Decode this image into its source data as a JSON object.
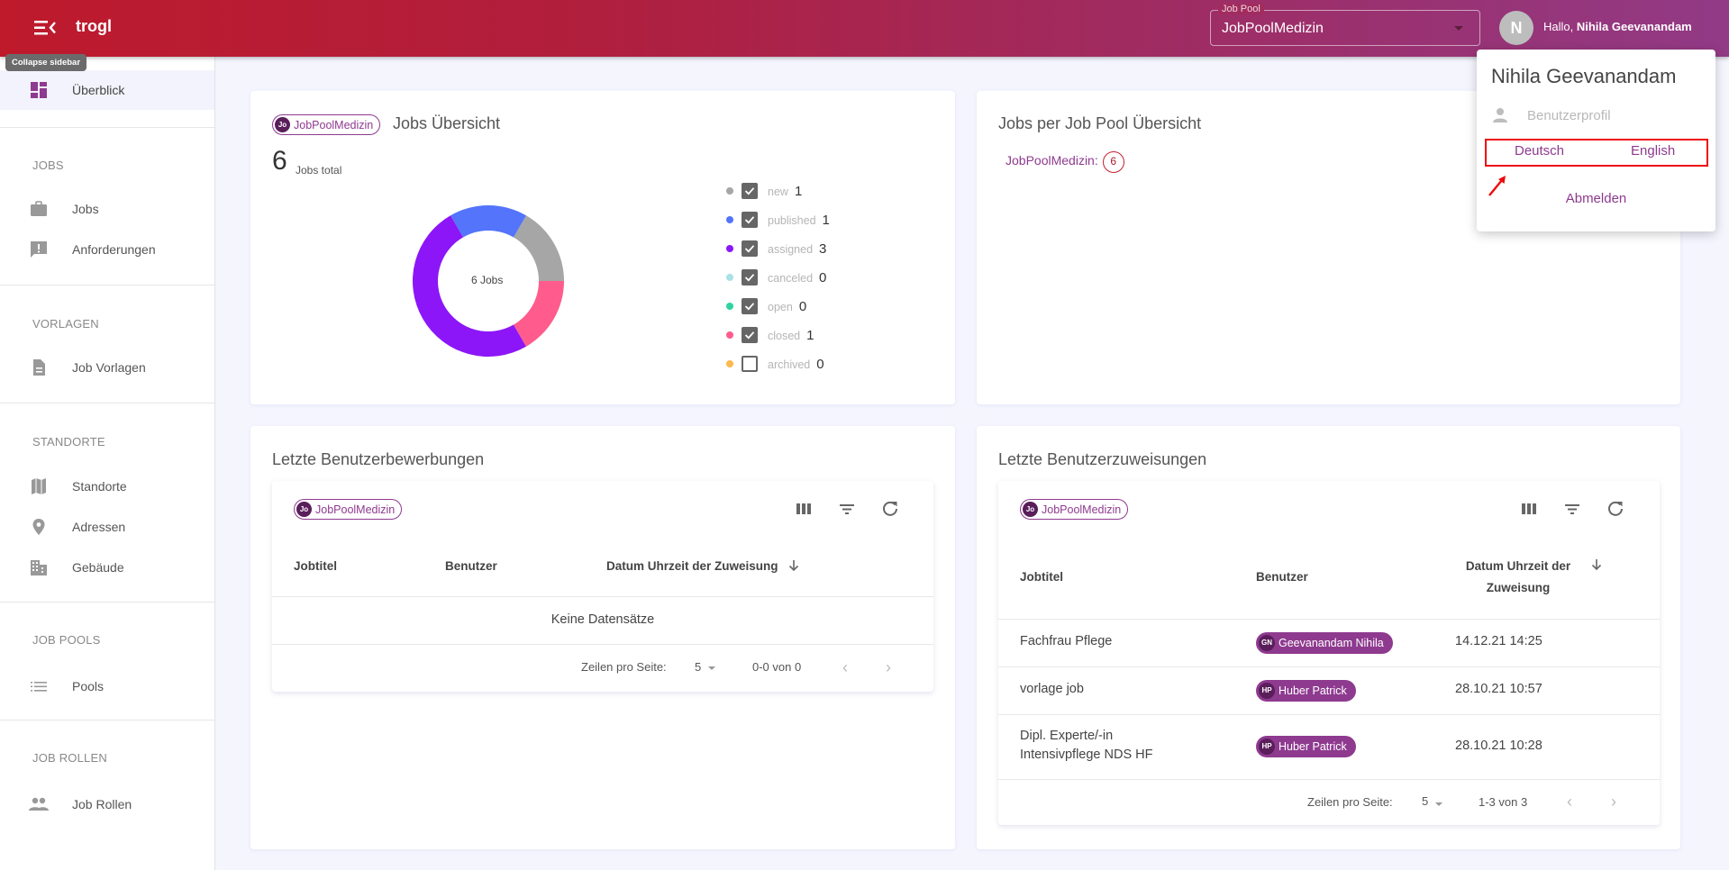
{
  "app": {
    "brand": "trogl",
    "collapse_tooltip": "Collapse sidebar"
  },
  "header": {
    "jobpool_label": "Job Pool",
    "jobpool_value": "JobPoolMedizin",
    "avatar_initial": "N",
    "greeting_prefix": "Hallo, ",
    "greeting_name": "Nihila Geevanandam"
  },
  "user_menu": {
    "name": "Nihila Geevanandam",
    "profile_label": "Benutzerprofil",
    "languages": [
      "Deutsch",
      "English"
    ],
    "logout_label": "Abmelden",
    "highlight_color": "#ee0a0a"
  },
  "sidebar": {
    "overview": "Überblick",
    "sections": [
      {
        "title": "JOBS",
        "items": [
          "Jobs",
          "Anforderungen"
        ]
      },
      {
        "title": "VORLAGEN",
        "items": [
          "Job Vorlagen"
        ]
      },
      {
        "title": "STANDORTE",
        "items": [
          "Standorte",
          "Adressen",
          "Gebäude"
        ]
      },
      {
        "title": "JOB POOLS",
        "items": [
          "Pools"
        ]
      },
      {
        "title": "JOB ROLLEN",
        "items": [
          "Job Rollen"
        ]
      }
    ]
  },
  "jobs_overview": {
    "chip_initials": "Jo",
    "chip_label": "JobPoolMedizin",
    "title": "Jobs Übersicht",
    "total": "6",
    "total_label": "Jobs total",
    "center_label": "6 Jobs"
  },
  "chart_data": {
    "type": "pie",
    "subtype": "doughnut",
    "title": "Jobs Übersicht",
    "center_label": "6 Jobs",
    "categories": [
      "new",
      "published",
      "assigned",
      "canceled",
      "open",
      "closed",
      "archived"
    ],
    "values": [
      1,
      1,
      3,
      0,
      0,
      1,
      0
    ],
    "colors": [
      "#a6a6a6",
      "#5374fb",
      "#8c16f7",
      "#a9e1e6",
      "#2ed3a0",
      "#ff5c8d",
      "#ffb84d"
    ],
    "visible": [
      true,
      true,
      true,
      true,
      true,
      true,
      false
    ],
    "legend_position": "right"
  },
  "pool_overview": {
    "title": "Jobs per Job Pool Übersicht",
    "pools": [
      {
        "name": "JobPoolMedizin:",
        "count": "6"
      }
    ]
  },
  "applications": {
    "title": "Letzte Benutzerbewerbungen",
    "chip_initials": "Jo",
    "chip_label": "JobPoolMedizin",
    "columns": [
      "Jobtitel",
      "Benutzer",
      "Datum Uhrzeit der Zuweisung"
    ],
    "empty_text": "Keine Datensätze",
    "rows_per_page_label": "Zeilen pro Seite:",
    "rows_per_page": "5",
    "range": "0-0 von 0"
  },
  "assignments": {
    "title": "Letzte Benutzerzuweisungen",
    "chip_initials": "Jo",
    "chip_label": "JobPoolMedizin",
    "columns": [
      "Jobtitel",
      "Benutzer",
      "Datum Uhrzeit der",
      "Zuweisung"
    ],
    "rows": [
      {
        "job": [
          "Fachfrau Pflege"
        ],
        "user_initials": "GN",
        "user": "Geevanandam Nihila",
        "date": "14.12.21 14:25"
      },
      {
        "job": [
          "vorlage job"
        ],
        "user_initials": "HP",
        "user": "Huber Patrick",
        "date": "28.10.21 10:57"
      },
      {
        "job": [
          "Dipl. Experte/-in",
          "Intensivpflege NDS HF"
        ],
        "user_initials": "HP",
        "user": "Huber Patrick",
        "date": "28.10.21 10:28"
      }
    ],
    "rows_per_page_label": "Zeilen pro Seite:",
    "rows_per_page": "5",
    "range": "1-3 von 3"
  },
  "colors": {
    "accent": "#8e3a8f",
    "topbar_start": "#be1a2c",
    "topbar_end": "#923a86"
  }
}
